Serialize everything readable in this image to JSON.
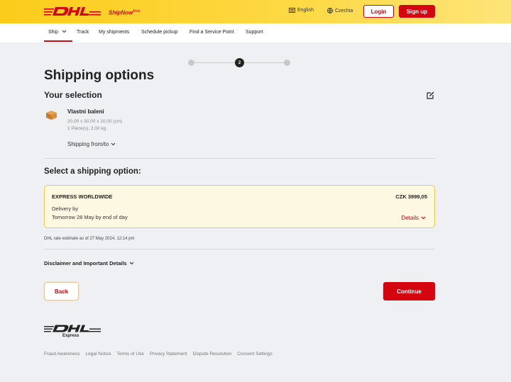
{
  "header": {
    "brand_sub": "ShipNow",
    "brand_sup": "Beta",
    "language": "English",
    "country": "Czechia",
    "login_label": "Login",
    "signup_label": "Sign up"
  },
  "nav": {
    "items": [
      "Ship",
      "Track",
      "My shipments",
      "Schedule pickup",
      "Find a Service Point",
      "Support"
    ]
  },
  "stepper": {
    "active_step": "2"
  },
  "page": {
    "title": "Shipping options",
    "selection_title": "Your selection",
    "package": {
      "name": "Vlastni baleni",
      "dims": "20,00 x 30,00 x 10,00 (cm)",
      "pieces": "1 Piece(s), 2,00 kg"
    },
    "shipping_from_to": "Shipping from/to",
    "option_title": "Select a shipping option:",
    "option": {
      "name": "EXPRESS WORLDWIDE",
      "price": "CZK 3999,05",
      "delivery_label": "Delivery by",
      "delivery_date": "Tomorrow 28 May by end of day",
      "details_label": "Details"
    },
    "rate_note": "DHL rate estimate as of 27 May 2024, 12:14 pm",
    "disclaimer": "Disclaimer and Important Details",
    "back_label": "Back",
    "continue_label": "Continue"
  },
  "footer": {
    "express": "Express",
    "links": [
      "Fraud Awareness",
      "Legal Notice",
      "Terms of Use",
      "Privacy Statement",
      "Dispute Resolution",
      "Consent Settings"
    ]
  },
  "colors": {
    "brand_yellow": "#fcd01f",
    "brand_red": "#d40511"
  }
}
